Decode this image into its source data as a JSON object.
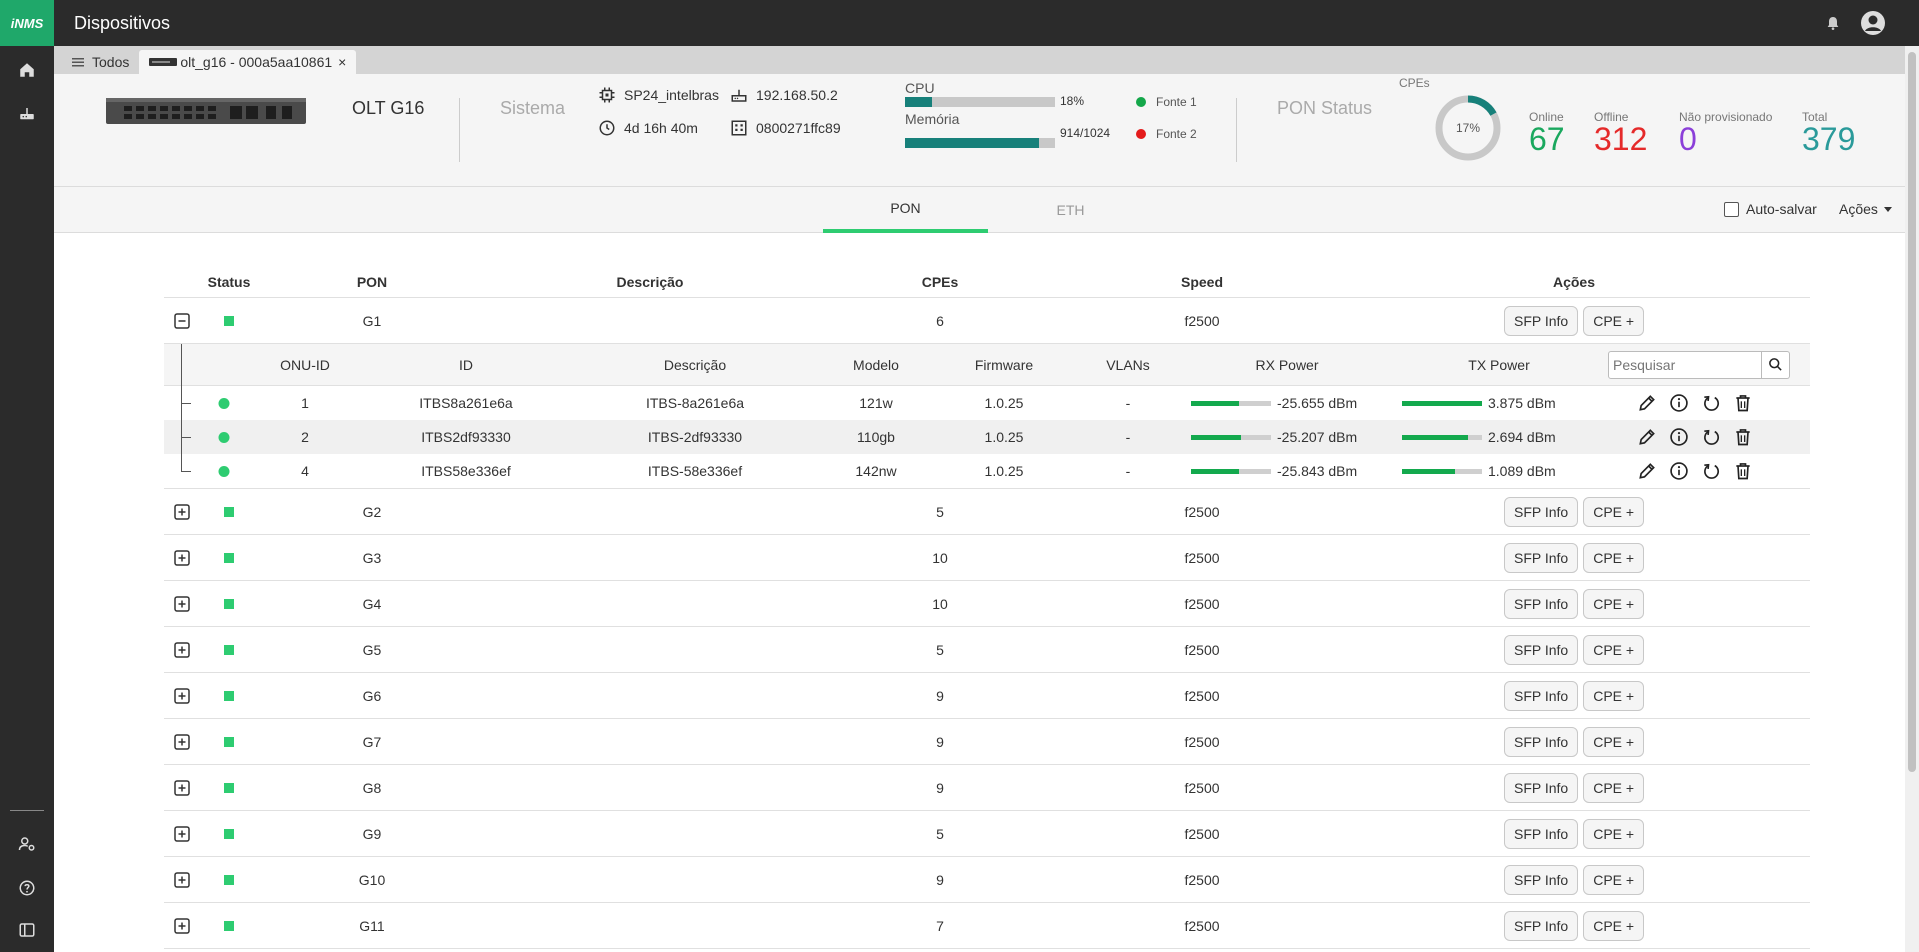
{
  "app": {
    "logo": "iNMS",
    "title": "Dispositivos"
  },
  "tabs": [
    {
      "label": "Todos"
    },
    {
      "label": "olt_g16 - 000a5aa10861",
      "close": "×"
    }
  ],
  "device": {
    "name": "OLT G16",
    "section_system": "Sistema",
    "hostname": "SP24_intelbras",
    "uptime": "4d 16h 40m",
    "ip": "192.168.50.2",
    "serial": "0800271ffc89",
    "cpu_label": "CPU",
    "cpu_value": "18%",
    "cpu_fraction": 0.18,
    "mem_label": "Memória",
    "mem_value": "914/1024",
    "mem_fraction": 0.893,
    "power1_label": "Fonte 1",
    "power1_color": "#14a74a",
    "power2_label": "Fonte 2",
    "power2_color": "#e41b1b",
    "pon_status_label": "PON Status",
    "cpes_label": "CPEs",
    "cpes_percent": "17%",
    "cpes_fraction": 0.17,
    "online_label": "Online",
    "online": "67",
    "online_color": "#1aa85e",
    "offline_label": "Offline",
    "offline": "312",
    "offline_color": "#e52a2a",
    "unprov_label": "Não provisionado",
    "unprov": "0",
    "unprov_color": "#8b3fd9",
    "total_label": "Total",
    "total": "379",
    "total_color": "#2a9a9a"
  },
  "main_tabs": {
    "pon": "PON",
    "eth": "ETH",
    "autosave": "Auto-salvar",
    "actions": "Ações"
  },
  "table": {
    "headers": {
      "status": "Status",
      "pon": "PON",
      "description": "Descrição",
      "cpes": "CPEs",
      "speed": "Speed",
      "actions": "Ações"
    },
    "sfp_label": "SFP Info",
    "cpe_label": "CPE +",
    "rows": [
      {
        "pon": "G1",
        "cpes": "6",
        "speed": "f2500",
        "expanded": true
      },
      {
        "pon": "G2",
        "cpes": "5",
        "speed": "f2500"
      },
      {
        "pon": "G3",
        "cpes": "10",
        "speed": "f2500"
      },
      {
        "pon": "G4",
        "cpes": "10",
        "speed": "f2500"
      },
      {
        "pon": "G5",
        "cpes": "5",
        "speed": "f2500"
      },
      {
        "pon": "G6",
        "cpes": "9",
        "speed": "f2500"
      },
      {
        "pon": "G7",
        "cpes": "9",
        "speed": "f2500"
      },
      {
        "pon": "G8",
        "cpes": "9",
        "speed": "f2500"
      },
      {
        "pon": "G9",
        "cpes": "5",
        "speed": "f2500"
      },
      {
        "pon": "G10",
        "cpes": "9",
        "speed": "f2500"
      },
      {
        "pon": "G11",
        "cpes": "7",
        "speed": "f2500"
      }
    ]
  },
  "onu": {
    "headers": {
      "onu_id": "ONU-ID",
      "id": "ID",
      "description": "Descrição",
      "model": "Modelo",
      "firmware": "Firmware",
      "vlans": "VLANs",
      "rx": "RX Power",
      "tx": "TX Power"
    },
    "search_placeholder": "Pesquisar",
    "rows": [
      {
        "onu_id": "1",
        "id": "ITBS8a261e6a",
        "description": "ITBS-8a261e6a",
        "model": "121w",
        "firmware": "1.0.25",
        "vlans": "-",
        "rx": "-25.655 dBm",
        "rx_level": 0.6,
        "tx": "3.875 dBm",
        "tx_level": 1.0
      },
      {
        "onu_id": "2",
        "id": "ITBS2df93330",
        "description": "ITBS-2df93330",
        "model": "110gb",
        "firmware": "1.0.25",
        "vlans": "-",
        "rx": "-25.207 dBm",
        "rx_level": 0.62,
        "tx": "2.694 dBm",
        "tx_level": 0.83
      },
      {
        "onu_id": "4",
        "id": "ITBS58e336ef",
        "description": "ITBS-58e336ef",
        "model": "142nw",
        "firmware": "1.0.25",
        "vlans": "-",
        "rx": "-25.843 dBm",
        "rx_level": 0.6,
        "tx": "1.089 dBm",
        "tx_level": 0.66
      }
    ]
  }
}
